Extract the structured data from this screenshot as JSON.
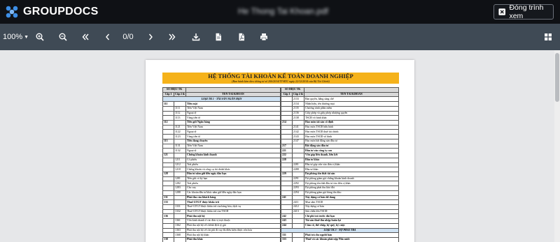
{
  "app": {
    "brand": "GROUPDOCS",
    "file_name": "He Thong Tai Khoan.pdf",
    "close_button": "Đóng trình xem"
  },
  "toolbar": {
    "zoom": "100%",
    "page_counter": "0/0",
    "icons": [
      "zoom-in-icon",
      "zoom-out-icon",
      "first-page-icon",
      "previous-page-icon",
      "next-page-icon",
      "last-page-icon",
      "download-icon",
      "file-icon",
      "pdf-icon",
      "print-icon",
      "thumbnails-icon"
    ]
  },
  "document": {
    "title": "HỆ THỐNG TÀI KHOẢN KẾ TOÁN DOANH NGHIỆP",
    "subtitle": "(Ban hành kèm theo thông tư số 200/2014/TT-BTC ngày 22/12/2014 của Bộ Tài Chính)",
    "left_rows": [
      {
        "t": "hd1",
        "c1": "SỐ HIỆU TK"
      },
      {
        "t": "hd2",
        "c1": "Cấp 1",
        "c2": "Cấp 2 & 3",
        "c3": "TÊN TÀI KHOẢN"
      },
      {
        "t": "sec",
        "c3": "LOẠI TK 1 - TÀI SẢN NGẮN HẠN"
      },
      {
        "t": "b",
        "c1": "111",
        "c3": "Tiền mặt"
      },
      {
        "c2": "1111",
        "c3": "Tiền Việt Nam"
      },
      {
        "c2": "1112",
        "c3": "Ngoại tệ"
      },
      {
        "c2": "1113",
        "c3": "Vàng tiền tệ"
      },
      {
        "t": "b",
        "c1": "112",
        "c3": "Tiền gửi Ngân hàng"
      },
      {
        "c2": "1121",
        "c3": "Tiền Việt Nam"
      },
      {
        "c2": "1122",
        "c3": "Ngoại tệ"
      },
      {
        "c2": "1123",
        "c3": "Vàng tiền tệ"
      },
      {
        "t": "b",
        "c1": "113",
        "c3": "Tiền đang chuyển"
      },
      {
        "c2": "1131",
        "c3": "Tiền Việt Nam"
      },
      {
        "c2": "1132",
        "c3": "Ngoại tệ"
      },
      {
        "t": "b",
        "c1": "121",
        "c3": "Chứng khoán kinh doanh"
      },
      {
        "c2": "1211",
        "c3": "Cổ phiếu"
      },
      {
        "c2": "1212",
        "c3": "Trái phiếu"
      },
      {
        "c2": "1218",
        "c3": "Chứng khoán và công cụ tài chính khác"
      },
      {
        "t": "b",
        "c1": "128",
        "c3": "Đầu tư nắm giữ đến ngày đáo hạn"
      },
      {
        "c2": "1281",
        "c3": "Tiền gửi có kỳ hạn"
      },
      {
        "c2": "1282",
        "c3": "Trái phiếu"
      },
      {
        "c2": "1283",
        "c3": "Cho vay"
      },
      {
        "c2": "1288",
        "c3": "Các khoản đầu tư khác nắm giữ đến ngày đáo hạn"
      },
      {
        "t": "b",
        "c1": "131",
        "c3": "Phải thu của khách hàng"
      },
      {
        "t": "b",
        "c1": "133",
        "c3": "Thuế GTGT được khấu trừ"
      },
      {
        "c2": "1331",
        "c3": "Thuế GTGT được khấu trừ của hàng hóa, dịch vụ"
      },
      {
        "c2": "1332",
        "c3": "Thuế GTGT được khấu trừ của TSCĐ"
      },
      {
        "t": "b",
        "c1": "136",
        "c3": "Phải thu nội bộ"
      },
      {
        "c2": "1361",
        "c3": "Vốn kinh doanh ở các đơn vị trực thuộc"
      },
      {
        "c2": "1362",
        "c3": "Phải thu nội bộ về chênh lệch tỷ giá"
      },
      {
        "c2": "1363",
        "c3": "Phải thu nội bộ về chi phí đi vay đủ điều kiện được vốn hóa"
      },
      {
        "c2": "1368",
        "c3": "Phải thu nội bộ khác"
      },
      {
        "t": "b",
        "c1": "138",
        "c3": "Phải thu khác"
      },
      {
        "c2": "1381",
        "c3": "Tài sản thiếu chờ xử lý"
      }
    ],
    "right_rows": [
      {
        "t": "hd1",
        "c1": "SỐ HIỆU TK"
      },
      {
        "t": "hd2",
        "c1": "Cấp 1",
        "c2": "Cấp 2 & 3",
        "c3": "TÊN TÀI KHOẢN"
      },
      {
        "c2": "2133",
        "c3": "Bản quyền, bằng sáng chế"
      },
      {
        "c2": "2134",
        "c3": "Nhãn hiệu, tên thương mại"
      },
      {
        "c2": "2135",
        "c3": "Chương trình phần mềm"
      },
      {
        "c2": "2136",
        "c3": "Giấy phép và giấy phép nhượng quyền"
      },
      {
        "c2": "2138",
        "c3": "TSCĐ vô hình khác"
      },
      {
        "t": "b",
        "c1": "214",
        "c3": "Hao mòn tài sản cố định"
      },
      {
        "c2": "2141",
        "c3": "Hao mòn TSCĐ hữu hình"
      },
      {
        "c2": "2142",
        "c3": "Hao mòn TSCĐ thuê tài chính"
      },
      {
        "c2": "2143",
        "c3": "Hao mòn TSCĐ vô hình"
      },
      {
        "c2": "2147",
        "c3": "Hao mòn bất động sản đầu tư"
      },
      {
        "t": "b",
        "c1": "217",
        "c3": "Bất động sản đầu tư"
      },
      {
        "t": "b",
        "c1": "221",
        "c3": "Đầu tư vào công ty con"
      },
      {
        "t": "b",
        "c1": "222",
        "c3": "Vốn góp liên doanh, liên kết"
      },
      {
        "t": "b",
        "c1": "228",
        "c3": "Đầu tư khác"
      },
      {
        "c2": "2281",
        "c3": "Đầu tư góp vốn vào đơn vị khác"
      },
      {
        "c2": "2288",
        "c3": "Đầu tư khác"
      },
      {
        "t": "b",
        "c1": "229",
        "c3": "Dự phòng tổn thất tài sản"
      },
      {
        "c2": "2291",
        "c3": "Dự phòng giảm giá chứng khoán kinh doanh"
      },
      {
        "c2": "2292",
        "c3": "Dự phòng tổn thất đầu tư vào đơn vị khác"
      },
      {
        "c2": "2293",
        "c3": "Dự phòng phải thu khó đòi"
      },
      {
        "c2": "2294",
        "c3": "Dự phòng giảm giá hàng tồn kho"
      },
      {
        "t": "b",
        "c1": "241",
        "c3": "Xây dựng cơ bản dở dang"
      },
      {
        "c2": "2411",
        "c3": "Mua sắm TSCĐ"
      },
      {
        "c2": "2412",
        "c3": "Xây dựng cơ bản"
      },
      {
        "c2": "2413",
        "c3": "Sửa chữa lớn TSCĐ"
      },
      {
        "t": "b",
        "c1": "242",
        "c3": "Chi phí trả trước dài hạn"
      },
      {
        "t": "b",
        "c1": "243",
        "c3": "Tài sản thuế thu nhập hoãn lại"
      },
      {
        "t": "b",
        "c1": "244",
        "c3": "Cầm cố, thế chấp, ký quỹ, ký cược"
      },
      {
        "t": "sec",
        "c3": "LOẠI TK 3 - NỢ PHẢI TRẢ"
      },
      {
        "t": "b",
        "c1": "331",
        "c3": "Phải trả cho người bán"
      },
      {
        "t": "b",
        "c1": "333",
        "c3": "Thuế và các khoản phải nộp Nhà nước"
      },
      {
        "c2": "3331",
        "c3": "Thuế giá trị gia tăng phải nộp"
      }
    ]
  }
}
